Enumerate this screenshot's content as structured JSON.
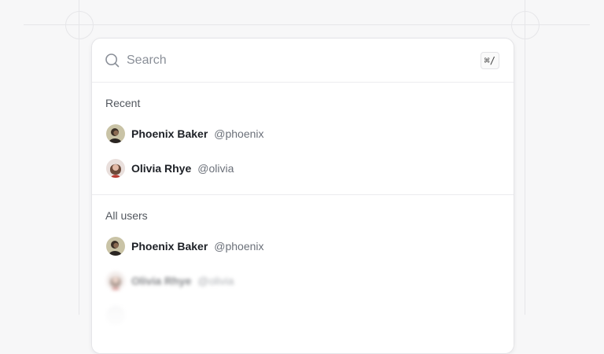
{
  "search": {
    "placeholder": "Search",
    "shortcut": "⌘/"
  },
  "recent": {
    "title": "Recent",
    "users": [
      {
        "name": "Phoenix Baker",
        "handle": "@phoenix"
      },
      {
        "name": "Olivia Rhye",
        "handle": "@olivia"
      }
    ]
  },
  "all_users": {
    "title": "All users",
    "users": [
      {
        "name": "Phoenix Baker",
        "handle": "@phoenix"
      },
      {
        "name": "Olivia Rhye",
        "handle": "@olivia"
      }
    ]
  },
  "colors": {
    "background": "#f7f7f8",
    "panel": "#ffffff",
    "text_primary": "#1d2026",
    "text_secondary": "#6b7079"
  }
}
